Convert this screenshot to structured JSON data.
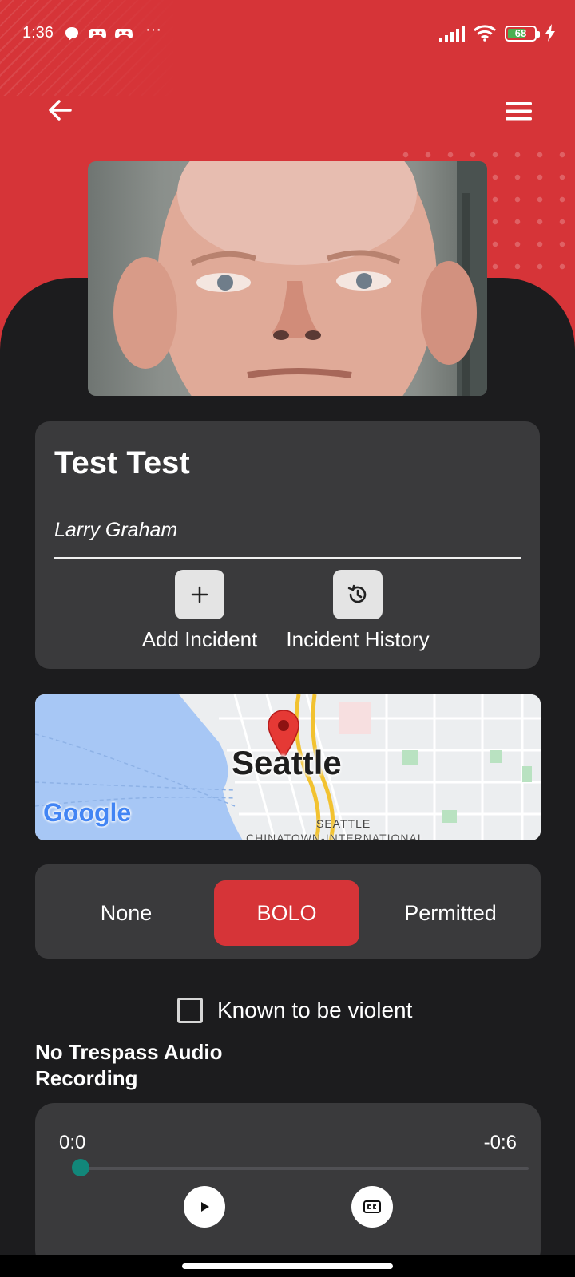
{
  "status_bar": {
    "time": "1:36",
    "more_indicator": "···",
    "battery_level": "68",
    "battery_fraction": 0.68,
    "icons": [
      "chat-bubble-icon",
      "game-controller-icon",
      "game-controller-icon",
      "signal-icon",
      "wifi-icon",
      "battery-icon",
      "charging-icon"
    ]
  },
  "header": {
    "back_icon": "arrow-left-icon",
    "menu_icon": "hamburger-menu-icon"
  },
  "person": {
    "name": "Test Test",
    "alias": "Larry Graham"
  },
  "actions": [
    {
      "label": "Add Incident",
      "icon": "plus-icon"
    },
    {
      "label": "Incident History",
      "icon": "history-icon"
    }
  ],
  "map": {
    "city_label": "Seattle",
    "area_label": "SEATTLE",
    "area_label_2": "CHINATOWN-INTERNATIONAL",
    "brand": "Google"
  },
  "status_options": {
    "options": [
      "None",
      "BOLO",
      "Permitted"
    ],
    "selected": "BOLO"
  },
  "violent": {
    "label": "Known to be violent",
    "checked": false
  },
  "audio": {
    "section_title": "No Trespass Audio Recording",
    "elapsed": "0:0",
    "remaining": "-0:6",
    "progress": 0,
    "play_icon": "play-icon",
    "captions_icon": "closed-captions-icon"
  },
  "colors": {
    "accent_red": "#d63438",
    "card_bg": "#3a3a3c",
    "page_bg": "#1c1c1e",
    "progress_thumb": "#12877a"
  }
}
